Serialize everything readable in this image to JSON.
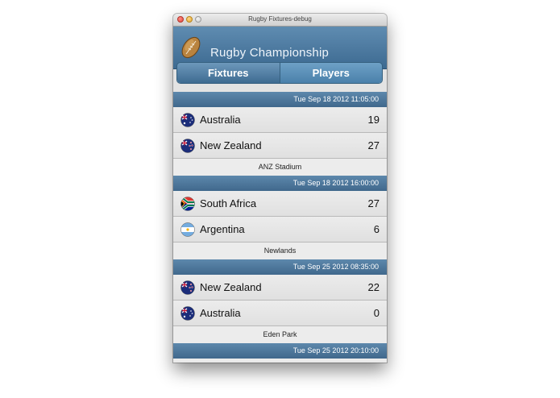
{
  "window": {
    "title": "Rugby Fixtures-debug"
  },
  "header": {
    "title": "Rugby Championship"
  },
  "tabs": [
    {
      "label": "Fixtures",
      "active": true
    },
    {
      "label": "Players",
      "active": false
    }
  ],
  "fixtures": [
    {
      "datetime": "Tue Sep 18 2012 11:05:00",
      "home": {
        "team": "Australia",
        "score": "19",
        "flag": "australia-flag-icon"
      },
      "away": {
        "team": "New Zealand",
        "score": "27",
        "flag": "new-zealand-flag-icon"
      },
      "venue": "ANZ Stadium"
    },
    {
      "datetime": "Tue Sep 18 2012 16:00:00",
      "home": {
        "team": "South Africa",
        "score": "27",
        "flag": "south-africa-flag-icon"
      },
      "away": {
        "team": "Argentina",
        "score": "6",
        "flag": "argentina-flag-icon"
      },
      "venue": "Newlands"
    },
    {
      "datetime": "Tue Sep 25 2012 08:35:00",
      "home": {
        "team": "New Zealand",
        "score": "22",
        "flag": "new-zealand-flag-icon"
      },
      "away": {
        "team": "Australia",
        "score": "0",
        "flag": "australia-flag-icon"
      },
      "venue": "Eden Park"
    },
    {
      "datetime": "Tue Sep 25 2012 20:10:00"
    }
  ],
  "colors": {
    "header_blue": "#4a77a0",
    "date_bar": "#4d789c",
    "row_bg": "#e6e6e6"
  }
}
